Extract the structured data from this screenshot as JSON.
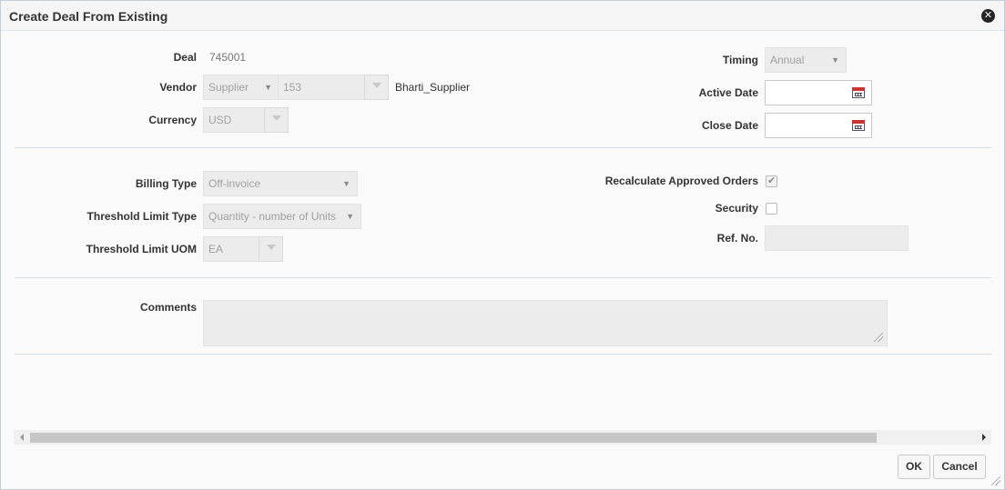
{
  "dialog": {
    "title": "Create Deal From Existing"
  },
  "deal": {
    "label": "Deal",
    "value": "745001"
  },
  "vendor": {
    "label": "Vendor",
    "type": "Supplier",
    "id": "153",
    "name": "Bharti_Supplier"
  },
  "currency": {
    "label": "Currency",
    "value": "USD"
  },
  "timing": {
    "label": "Timing",
    "value": "Annual"
  },
  "active_date": {
    "label": "Active Date",
    "value": ""
  },
  "close_date": {
    "label": "Close Date",
    "value": ""
  },
  "billing_type": {
    "label": "Billing Type",
    "value": "Off-invoice"
  },
  "threshold_limit_type": {
    "label": "Threshold Limit Type",
    "value": "Quantity - number of Units"
  },
  "threshold_limit_uom": {
    "label": "Threshold Limit UOM",
    "value": "EA"
  },
  "recalculate": {
    "label": "Recalculate Approved Orders",
    "checked": true
  },
  "security": {
    "label": "Security",
    "checked": false
  },
  "ref_no": {
    "label": "Ref. No.",
    "value": ""
  },
  "comments": {
    "label": "Comments",
    "value": ""
  },
  "buttons": {
    "ok": "OK",
    "cancel": "Cancel"
  },
  "icons": {
    "close": "close-icon",
    "calendar": "calendar-icon",
    "dropdown": "chevron-down-icon",
    "checkbox": "check-icon"
  }
}
